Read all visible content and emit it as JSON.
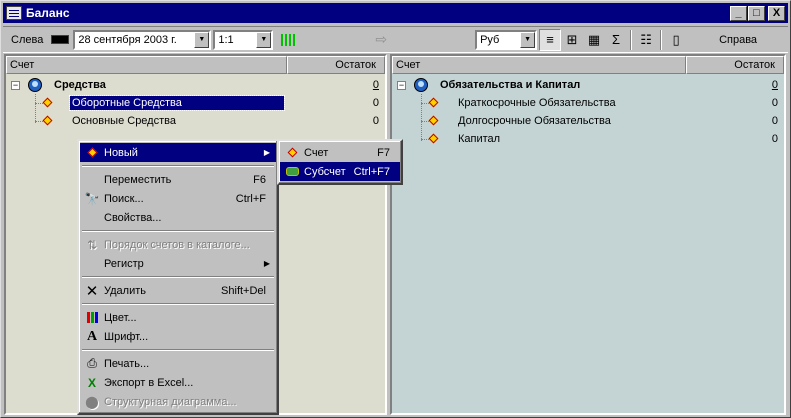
{
  "window": {
    "title": "Баланс",
    "minimize": "_",
    "maximize": "□",
    "close": "X"
  },
  "toolbar": {
    "left_label": "Слева",
    "date": "28 сентября 2003 г.",
    "scale": "1:1",
    "currency": "Руб",
    "right_label": "Справа",
    "icons": [
      "align-icon",
      "grid-icon",
      "columns-icon",
      "sum-icon",
      "filter-icon",
      "book-icon"
    ]
  },
  "left_pane": {
    "col_account": "Счет",
    "col_balance": "Остаток",
    "root": {
      "label": "Средства",
      "value": "0"
    },
    "children": [
      {
        "label": "Оборотные Средства",
        "value": "0",
        "selected": true
      },
      {
        "label": "Основные Средства",
        "value": "0",
        "selected": false
      }
    ]
  },
  "right_pane": {
    "col_account": "Счет",
    "col_balance": "Остаток",
    "root": {
      "label": "Обязательства и Капитал",
      "value": "0"
    },
    "children": [
      {
        "label": "Краткосрочные Обязательства",
        "value": "0"
      },
      {
        "label": "Долгосрочные Обязательства",
        "value": "0"
      },
      {
        "label": "Капитал",
        "value": "0"
      }
    ]
  },
  "context_menu": {
    "new": "Новый",
    "move": "Переместить",
    "move_sc": "F6",
    "search": "Поиск...",
    "search_sc": "Ctrl+F",
    "properties": "Свойства...",
    "order": "Порядок счетов в каталоге...",
    "register": "Регистр",
    "delete": "Удалить",
    "delete_sc": "Shift+Del",
    "color": "Цвет...",
    "font": "Шрифт...",
    "print": "Печать...",
    "export": "Экспорт в Excel...",
    "diagram": "Структурная диаграмма..."
  },
  "submenu": {
    "account": "Счет",
    "account_sc": "F7",
    "subaccount": "Субсчет",
    "subaccount_sc": "Ctrl+F7"
  }
}
